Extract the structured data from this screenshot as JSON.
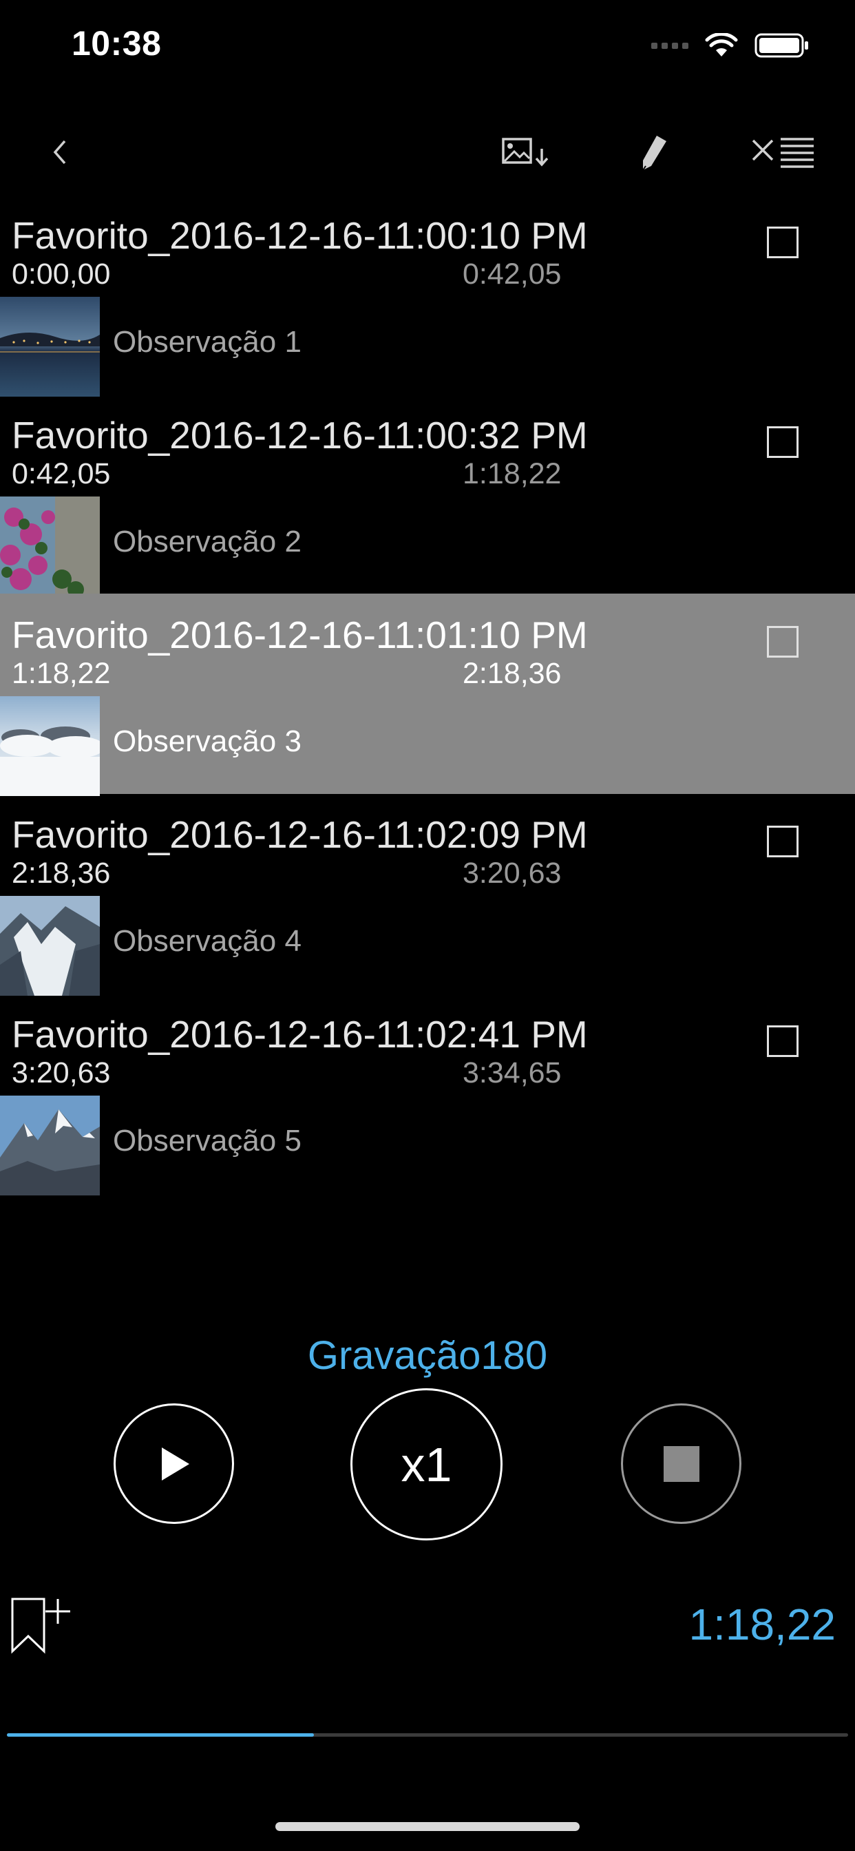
{
  "status_bar": {
    "time": "10:38"
  },
  "toolbar": {
    "back_icon": "chevron-left-icon",
    "export_icon": "image-download-icon",
    "edit_icon": "pencil-icon",
    "clear_icon": "clear-list-icon"
  },
  "bookmarks": [
    {
      "title": "Favorito_2016-12-16-11:00:10 PM",
      "start": "0:00,00",
      "end": "0:42,05",
      "note": "Observação 1",
      "checked": false,
      "selected": false,
      "thumb": "night-harbor"
    },
    {
      "title": "Favorito_2016-12-16-11:00:32 PM",
      "start": "0:42,05",
      "end": "1:18,22",
      "note": "Observação 2",
      "checked": false,
      "selected": false,
      "thumb": "flowers"
    },
    {
      "title": "Favorito_2016-12-16-11:01:10 PM",
      "start": "1:18,22",
      "end": "2:18,36",
      "note": "Observação 3",
      "checked": false,
      "selected": true,
      "thumb": "clouds"
    },
    {
      "title": "Favorito_2016-12-16-11:02:09 PM",
      "start": "2:18,36",
      "end": "3:20,63",
      "note": "Observação 4",
      "checked": false,
      "selected": false,
      "thumb": "glacier"
    },
    {
      "title": "Favorito_2016-12-16-11:02:41 PM",
      "start": "3:20,63",
      "end": "3:34,65",
      "note": "Observação 5",
      "checked": false,
      "selected": false,
      "thumb": "snowy-peaks"
    }
  ],
  "player": {
    "recording_name": "Gravação180",
    "speed_label": "x1",
    "current_time": "1:18,22",
    "progress": 0.365
  },
  "colors": {
    "accent": "#4db1ea",
    "selected_row": "#888888",
    "background": "#000000"
  }
}
